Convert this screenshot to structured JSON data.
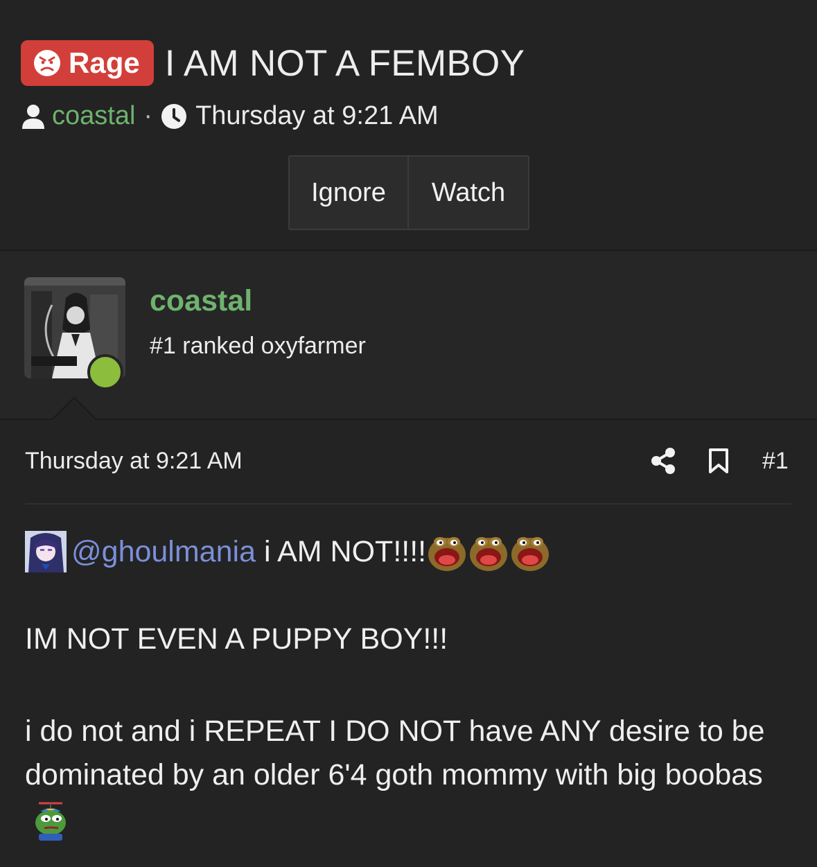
{
  "thread": {
    "prefix": "Rage",
    "title": "I AM NOT A FEMBOY",
    "author": "coastal",
    "separator": "·",
    "date": "Thursday at 9:21 AM",
    "buttons": {
      "ignore": "Ignore",
      "watch": "Watch"
    },
    "prefix_color": "#d23f3a"
  },
  "post": {
    "username": "coastal",
    "user_title": "#1 ranked oxyfarmer",
    "online": true,
    "date": "Thursday at 9:21 AM",
    "number": "#1",
    "mention": "@ghoulmania",
    "line1": "i AM NOT!!!!",
    "line2": "IM NOT EVEN A PUPPY BOY!!!",
    "paragraph3": "i do not and i REPEAT I DO NOT have ANY desire to be dominated by an older 6'4 goth mommy with big boobas",
    "emotes_after_line1": 3
  },
  "colors": {
    "username": "#6fb26f",
    "mention": "#7b8fd9",
    "online": "#8cbd3c",
    "background": "#232323"
  },
  "icons": [
    "angry-face-icon",
    "user-icon",
    "clock-icon",
    "share-icon",
    "bookmark-icon"
  ]
}
